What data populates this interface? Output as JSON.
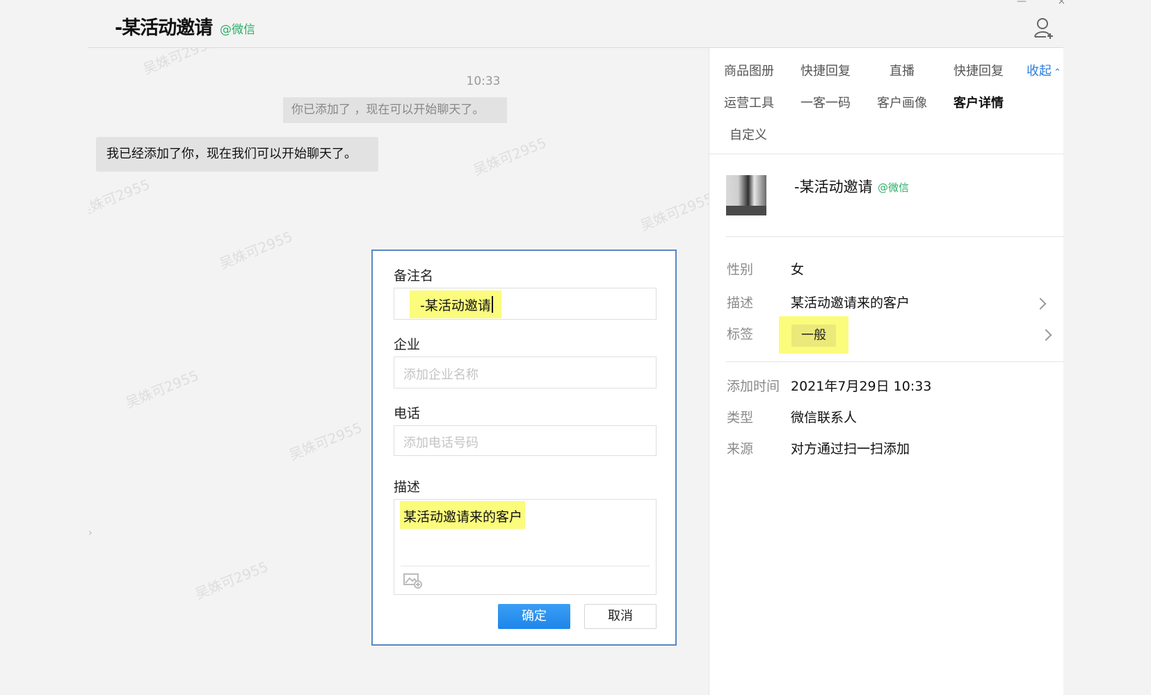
{
  "header": {
    "title": "-某活动邀请",
    "source_tag": "@微信",
    "add_contact_icon": "user-plus-icon"
  },
  "chat": {
    "timestamp": "10:33",
    "system_message": "你已添加了   ，现在可以开始聊天了。",
    "bubble_message": "我已经添加了你，现在我们可以开始聊天了。",
    "watermark": "吴姝可2955"
  },
  "dialog": {
    "remark_label": "备注名",
    "remark_value": "-某活动邀请",
    "company_label": "企业",
    "company_placeholder": "添加企业名称",
    "phone_label": "电话",
    "phone_placeholder": "添加电话号码",
    "desc_label": "描述",
    "desc_value": "某活动邀请来的客户",
    "image_icon": "image-add-icon",
    "confirm": "确定",
    "cancel": "取消"
  },
  "right_panel": {
    "tools": [
      "商品图册",
      "快捷回复",
      "直播",
      "快捷回复",
      "运营工具",
      "一客一码",
      "客户画像",
      "客户详情",
      "自定义"
    ],
    "collapse": "收起",
    "customer": {
      "name": "-某活动邀请",
      "source_tag": "@微信"
    },
    "info": {
      "gender_label": "性别",
      "gender_value": "女",
      "desc_label": "描述",
      "desc_value": "某活动邀请来的客户",
      "tag_label": "标签",
      "tag_value": "一般",
      "added_label": "添加时间",
      "added_value": "2021年7月29日 10:33",
      "type_label": "类型",
      "type_value": "微信联系人",
      "source_label": "来源",
      "source_value": "对方通过扫一扫添加"
    }
  },
  "colors": {
    "highlight": "#fbfb7c",
    "wechat_green": "#2aae67",
    "link_blue": "#2d7fe0",
    "confirm_blue": "#1e86ea",
    "dialog_border": "#5b86c7"
  }
}
